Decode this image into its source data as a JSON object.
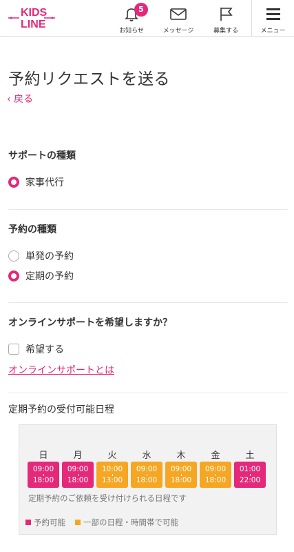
{
  "header": {
    "logo_text_top": "KIDS",
    "logo_text_bottom": "LINE",
    "notice_label": "お知らせ",
    "notice_count": "5",
    "message_label": "メッセージ",
    "recruit_label": "募集する",
    "menu_label": "メニュー"
  },
  "page": {
    "title": "予約リクエストを送る",
    "back_label": "‹ 戻る"
  },
  "support_type": {
    "heading": "サポートの種類",
    "options": [
      {
        "label": "家事代行",
        "checked": true
      }
    ]
  },
  "booking_type": {
    "heading": "予約の種類",
    "options": [
      {
        "label": "単発の予約",
        "checked": false
      },
      {
        "label": "定期の予約",
        "checked": true
      }
    ]
  },
  "online": {
    "heading": "オンラインサポートを希望しますか？",
    "checkbox_label": "希望する",
    "checked": false,
    "link_label": "オンラインサポートとは"
  },
  "schedule": {
    "heading": "定期予約の受付可能日程",
    "days": [
      {
        "day": "日",
        "start": "09:00",
        "end": "18:00",
        "status": "available"
      },
      {
        "day": "月",
        "start": "09:00",
        "end": "18:00",
        "status": "available"
      },
      {
        "day": "火",
        "start": "10:00",
        "end": "13:00",
        "status": "partial"
      },
      {
        "day": "水",
        "start": "09:00",
        "end": "18:00",
        "status": "partial"
      },
      {
        "day": "木",
        "start": "09:00",
        "end": "18:00",
        "status": "partial"
      },
      {
        "day": "金",
        "start": "09:00",
        "end": "18:00",
        "status": "partial"
      },
      {
        "day": "土",
        "start": "01:00",
        "end": "22:00",
        "status": "available"
      }
    ],
    "note": "定期予約のご依頼を受け付けられる日程です",
    "legend_available": "予約可能",
    "legend_partial": "一部の日程・時間帯で可能"
  },
  "colors": {
    "accent": "#e4287a",
    "partial": "#f5a623"
  }
}
